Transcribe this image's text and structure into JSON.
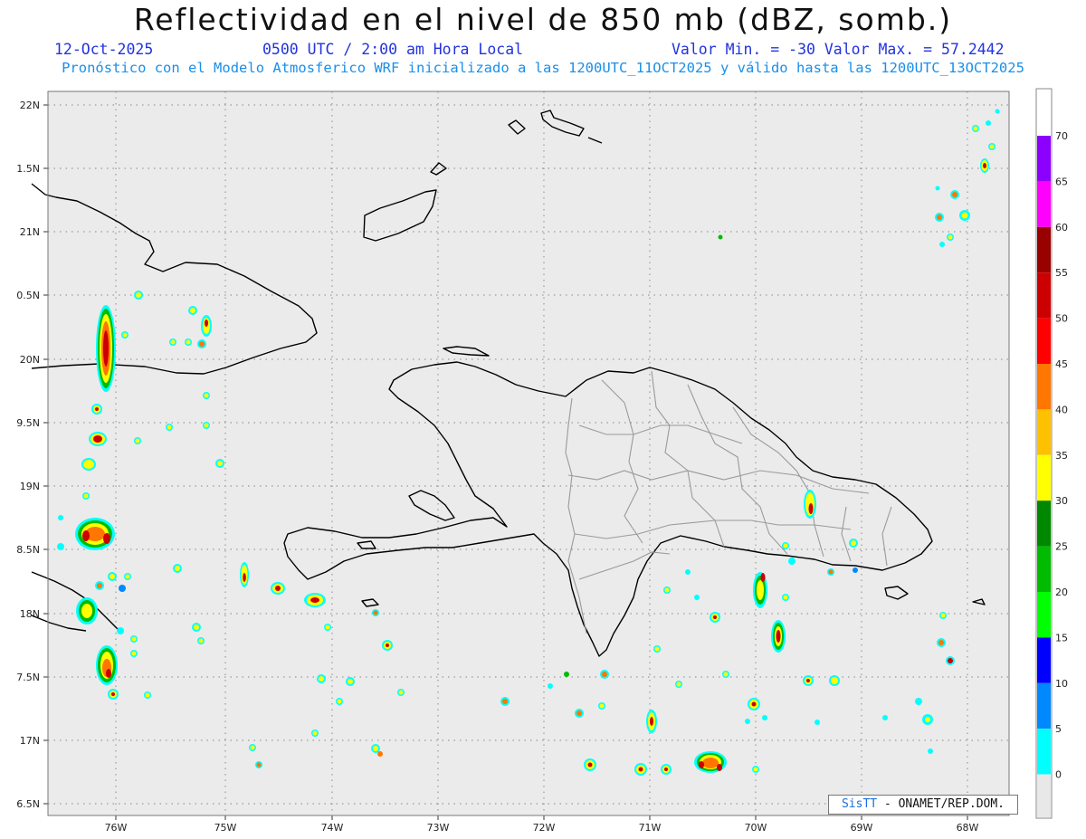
{
  "header": {
    "title": "Reflectividad en el nivel de 850 mb (dBZ, somb.)",
    "date": "12-Oct-2025",
    "time": "0500 UTC / 2:00 am Hora Local",
    "minmax": "Valor Min. = -30  Valor Max. = 57.2442",
    "forecast": "Pronóstico con el Modelo Atmosferico WRF inicializado a las 1200UTC_11OCT2025 y válido hasta las  1200UTC_13OCT2025"
  },
  "map": {
    "lat_labels": [
      "22N",
      "1.5N",
      "21N",
      "0.5N",
      "20N",
      "9.5N",
      "19N",
      "8.5N",
      "18N",
      "7.5N",
      "17N",
      "6.5N"
    ],
    "lon_labels": [
      "76W",
      "75W",
      "74W",
      "73W",
      "72W",
      "71W",
      "70W",
      "69W",
      "68W"
    ],
    "land_color": "#ebebeb",
    "coast_color": "#000000",
    "border_color": "#9a9a9a"
  },
  "colorbar": {
    "labels": [
      "70",
      "65",
      "60",
      "55",
      "50",
      "45",
      "40",
      "35",
      "30",
      "25",
      "20",
      "15",
      "10",
      "5",
      "0"
    ],
    "colors": [
      "#8b00ff",
      "#ff00ff",
      "#990000",
      "#cc0000",
      "#ff0000",
      "#ff7700",
      "#ffc000",
      "#ffff00",
      "#008800",
      "#00bb00",
      "#00ff00",
      "#0000ff",
      "#0088ff",
      "#00ffff",
      "#e8e8e8"
    ]
  },
  "credit": {
    "sis": "SisTT",
    "org": " - ONAMET/REP.DOM."
  }
}
